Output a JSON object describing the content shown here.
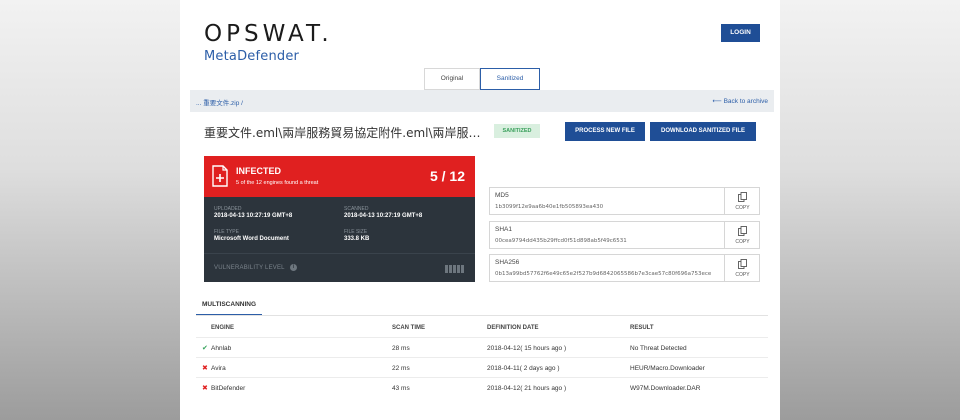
{
  "header": {
    "brand": "OPSWAT.",
    "product": "MetaDefender",
    "login_label": "LOGIN"
  },
  "tabs": [
    {
      "label": "Original File",
      "active": false
    },
    {
      "label": "Sanitized File",
      "active": true
    }
  ],
  "breadcrumb": {
    "path": "... 重要文件.zip /",
    "back_label": "Back to archive"
  },
  "file": {
    "name": "重要文件.eml\\兩岸服務貿易協定附件.eml\\兩岸服務貿...",
    "status_badge": "SANITIZED",
    "process_button": "PROCESS NEW FILE",
    "download_button": "DOWNLOAD SANITIZED FILE"
  },
  "verdict": {
    "title": "INFECTED",
    "subtitle": "5 of the 12 engines found a threat",
    "score": "5 / 12",
    "uploaded_label": "UPLOADED",
    "uploaded_value": "2018-04-13 10:27:19 GMT+8",
    "scanned_label": "SCANNED",
    "scanned_value": "2018-04-13 10:27:19 GMT+8",
    "filetype_label": "FILE TYPE",
    "filetype_value": "Microsoft Word Document",
    "filesize_label": "FILE SIZE",
    "filesize_value": "333.8 KB",
    "vulnerability_label": "VULNERABILITY LEVEL"
  },
  "hashes": [
    {
      "label": "MD5",
      "value": "1b3099f12e9aa6b40e1fb505893ea430",
      "copy": "COPY"
    },
    {
      "label": "SHA1",
      "value": "00cea9794dd435b29ffcd0f51d898ab5f49c6531",
      "copy": "COPY"
    },
    {
      "label": "SHA256",
      "value": "0b13a99bd57762f6e49c65e2f527b9d6842065586b7e3cae57c80f696a753ece",
      "copy": "COPY"
    }
  ],
  "multiscanning": {
    "tab_label": "MULTISCANNING",
    "columns": [
      "ENGINE",
      "SCAN TIME",
      "DEFINITION DATE",
      "RESULT"
    ],
    "rows": [
      {
        "status": "clean",
        "mark": "✔",
        "engine": "Ahnlab",
        "scan_time": "28 ms",
        "definition_date": "2018-04-12( 15 hours ago )",
        "result": "No Threat Detected"
      },
      {
        "status": "threat",
        "mark": "✖",
        "engine": "Avira",
        "scan_time": "22 ms",
        "definition_date": "2018-04-11( 2 days ago )",
        "result": "HEUR/Macro.Downloader"
      },
      {
        "status": "threat",
        "mark": "✖",
        "engine": "BitDefender",
        "scan_time": "43 ms",
        "definition_date": "2018-04-12( 21 hours ago )",
        "result": "W97M.Downloader.DAR"
      }
    ]
  },
  "colors": {
    "brand_blue": "#1f4e96",
    "infected_red": "#e02020",
    "panel_dark": "#2c343c",
    "sanitized_green": "#3aa05c"
  }
}
